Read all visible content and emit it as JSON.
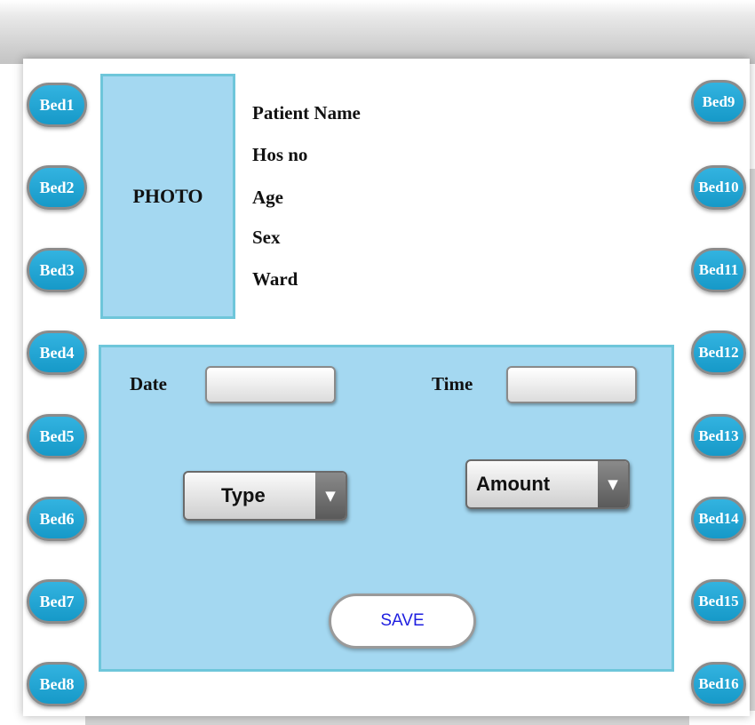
{
  "beds_left": [
    "Bed1",
    "Bed2",
    "Bed3",
    "Bed4",
    "Bed5",
    "Bed6",
    "Bed7",
    "Bed8"
  ],
  "beds_right": [
    "Bed9",
    "Bed10",
    "Bed11",
    "Bed12",
    "Bed13",
    "Bed14",
    "Bed15",
    "Bed16"
  ],
  "photo": {
    "label": "PHOTO"
  },
  "patient_info": {
    "name_label": "Patient Name",
    "hos_no_label": "Hos no",
    "age_label": "Age",
    "sex_label": "Sex",
    "ward_label": "Ward"
  },
  "form": {
    "date_label": "Date",
    "date_value": "",
    "time_label": "Time",
    "time_value": "",
    "type_select": "Type",
    "amount_select": "Amount",
    "save_label": "SAVE"
  },
  "colors": {
    "bed_button": "#1fa6d4",
    "panel_fill": "#a4d8f1",
    "panel_border": "#6ec6da",
    "save_text": "#1f1fe0"
  },
  "icons": {
    "select_arrow": "triangle-down"
  }
}
